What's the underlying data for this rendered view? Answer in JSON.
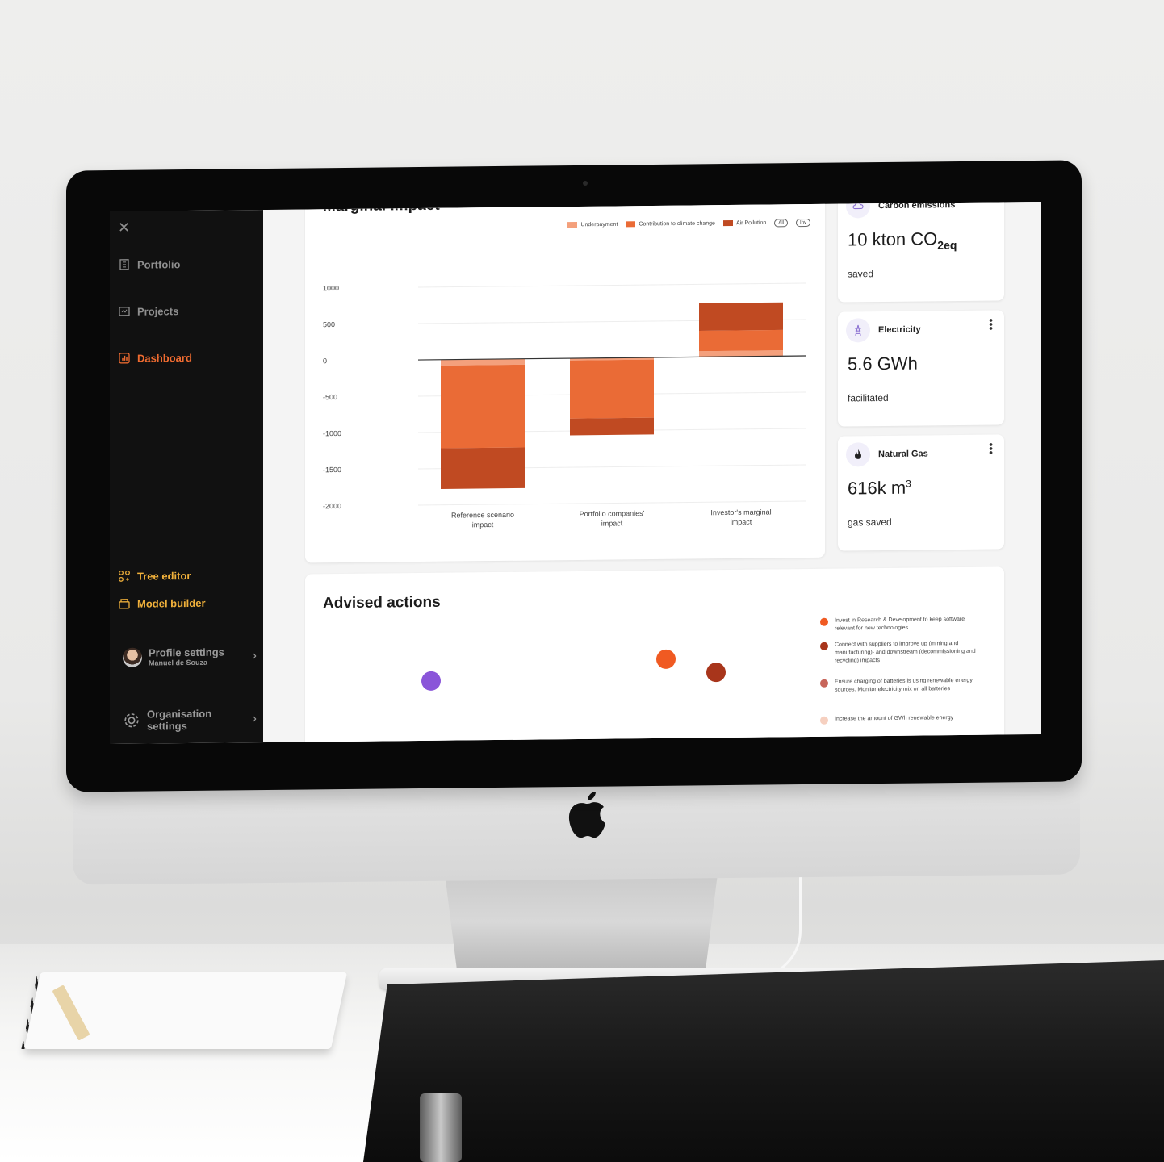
{
  "sidebar": {
    "close_icon_glyph": "✕",
    "nav": [
      {
        "label": "Portfolio",
        "icon": "building-icon"
      },
      {
        "label": "Projects",
        "icon": "clipboard-icon"
      },
      {
        "label": "Dashboard",
        "icon": "chart-icon"
      }
    ],
    "tools": [
      {
        "label": "Tree editor",
        "icon": "tree-icon"
      },
      {
        "label": "Model builder",
        "icon": "box-icon"
      }
    ],
    "profile": {
      "title": "Profile settings",
      "name": "Manuel de Souza"
    },
    "org": {
      "title": "Organisation",
      "subtitle": "settings"
    }
  },
  "marginal_card": {
    "title": "Marginal impact",
    "legend": [
      "Underpayment",
      "Contribution to climate change",
      "Air Pollution"
    ],
    "legend_pills": [
      "All",
      "Inv"
    ]
  },
  "chart_data": {
    "type": "bar",
    "stacked": true,
    "title": "Marginal impact",
    "categories": [
      "Reference scenario impact",
      "Portfolio companies' impact",
      "Investor's marginal impact"
    ],
    "category_lines": [
      [
        "Reference scenario",
        "impact"
      ],
      [
        "Portfolio companies'",
        "impact"
      ],
      [
        "Investor's marginal",
        "impact"
      ]
    ],
    "series": [
      {
        "name": "Underpayment",
        "values": [
          -80,
          -30,
          80
        ],
        "color": "#f4a07c"
      },
      {
        "name": "Contribution to climate change",
        "values": [
          -1140,
          -800,
          280
        ],
        "color": "#ea6b36"
      },
      {
        "name": "Air Pollution",
        "values": [
          -560,
          -230,
          380
        ],
        "color": "#c04a22"
      }
    ],
    "yticks": [
      "1000",
      "500",
      "0",
      "-500",
      "-1000",
      "-1500",
      "-2000"
    ],
    "ylim": [
      -2000,
      1000
    ],
    "grid": true,
    "legend_position": "top-right"
  },
  "stats": [
    {
      "label": "Carbon emissions",
      "value": "10 kton CO",
      "sub": "2eq",
      "sup": "",
      "desc": "saved",
      "icon": "cloud-icon"
    },
    {
      "label": "Electricity",
      "value": "5.6 GWh",
      "sub": "",
      "sup": "",
      "desc": "facilitated",
      "icon": "power-tower-icon"
    },
    {
      "label": "Natural Gas",
      "value": "616k m",
      "sub": "",
      "sup": "3",
      "desc": "gas saved",
      "icon": "flame-icon"
    }
  ],
  "advised": {
    "title": "Advised actions",
    "actions": [
      {
        "text": "Invest in Research & Development to keep software relevant for new technologies",
        "color": "#f05a22"
      },
      {
        "text": "Connect with suppliers to improve up (mining and manufacturing)- and downstream (decommissioning and recycling) impacts",
        "color": "#a8351b"
      },
      {
        "text": "Ensure charging of batteries is using renewable energy sources. Monitor electricity mix on all batteries",
        "color": "#c7655a"
      },
      {
        "text": "Increase the amount of GWh renewable energy",
        "color": "#f6d0c0"
      }
    ],
    "bubbles": [
      {
        "color": "#8a55d9"
      },
      {
        "color": "#f05a22"
      },
      {
        "color": "#a8351b"
      }
    ]
  }
}
